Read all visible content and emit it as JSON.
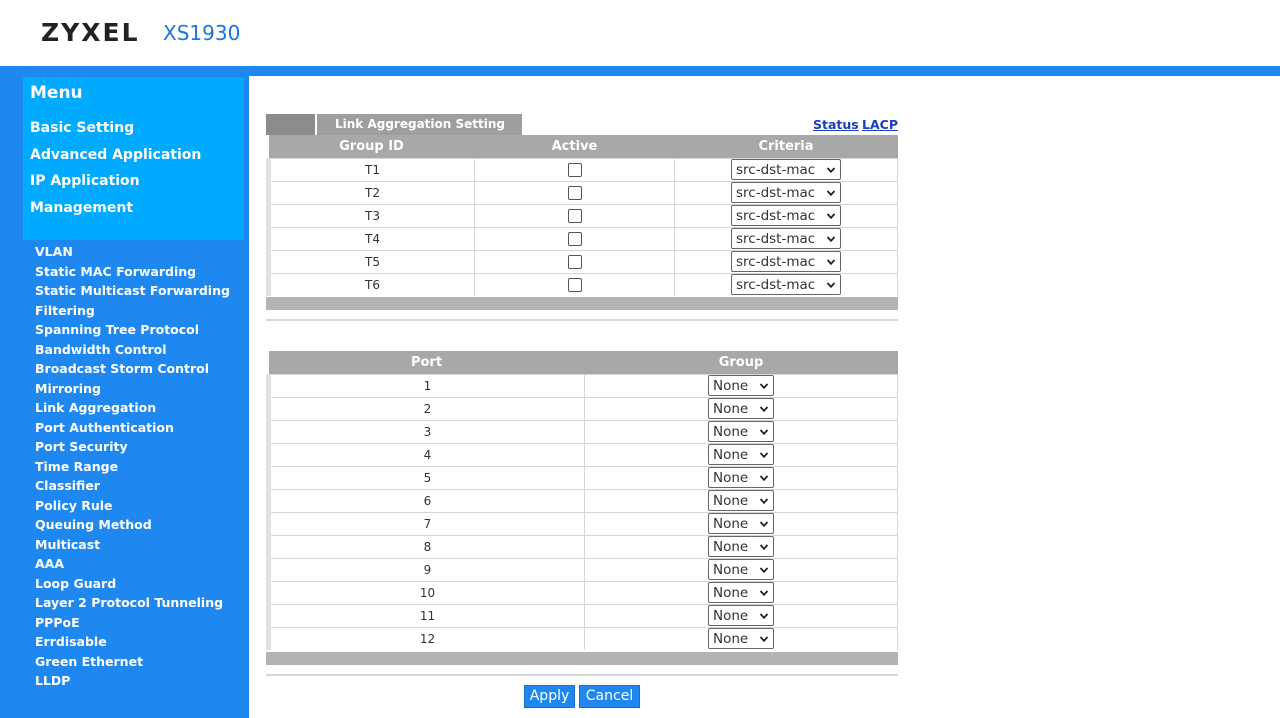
{
  "header": {
    "brand": "ZYXEL",
    "model": "XS1930"
  },
  "sidebar": {
    "menu_title": "Menu",
    "main_items": [
      "Basic Setting",
      "Advanced Application",
      "IP Application",
      "Management"
    ],
    "sub_items": [
      "VLAN",
      "Static MAC Forwarding",
      "Static Multicast Forwarding",
      "Filtering",
      "Spanning Tree Protocol",
      "Bandwidth Control",
      "Broadcast Storm Control",
      "Mirroring",
      "Link Aggregation",
      "Port Authentication",
      "Port Security",
      "Time Range",
      "Classifier",
      "Policy Rule",
      "Queuing Method",
      "Multicast",
      "AAA",
      "Loop Guard",
      "Layer 2 Protocol Tunneling",
      "PPPoE",
      "Errdisable",
      "Green Ethernet",
      "LLDP"
    ]
  },
  "page": {
    "tab_label": "Link Aggregation Setting",
    "links": {
      "status": "Status",
      "lacp": "LACP"
    },
    "groups_table": {
      "headers": {
        "group_id": "Group ID",
        "active": "Active",
        "criteria": "Criteria"
      },
      "rows": [
        {
          "group_id": "T1",
          "active": false,
          "criteria": "src-dst-mac"
        },
        {
          "group_id": "T2",
          "active": false,
          "criteria": "src-dst-mac"
        },
        {
          "group_id": "T3",
          "active": false,
          "criteria": "src-dst-mac"
        },
        {
          "group_id": "T4",
          "active": false,
          "criteria": "src-dst-mac"
        },
        {
          "group_id": "T5",
          "active": false,
          "criteria": "src-dst-mac"
        },
        {
          "group_id": "T6",
          "active": false,
          "criteria": "src-dst-mac"
        }
      ]
    },
    "ports_table": {
      "headers": {
        "port": "Port",
        "group": "Group"
      },
      "rows": [
        {
          "port": "1",
          "group": "None"
        },
        {
          "port": "2",
          "group": "None"
        },
        {
          "port": "3",
          "group": "None"
        },
        {
          "port": "4",
          "group": "None"
        },
        {
          "port": "5",
          "group": "None"
        },
        {
          "port": "6",
          "group": "None"
        },
        {
          "port": "7",
          "group": "None"
        },
        {
          "port": "8",
          "group": "None"
        },
        {
          "port": "9",
          "group": "None"
        },
        {
          "port": "10",
          "group": "None"
        },
        {
          "port": "11",
          "group": "None"
        },
        {
          "port": "12",
          "group": "None"
        }
      ]
    },
    "buttons": {
      "apply": "Apply",
      "cancel": "Cancel"
    }
  },
  "colors": {
    "primary": "#1e88f0",
    "menu_box": "#00aaff",
    "table_header": "#a8a8a8",
    "link": "#1a3fbf"
  }
}
